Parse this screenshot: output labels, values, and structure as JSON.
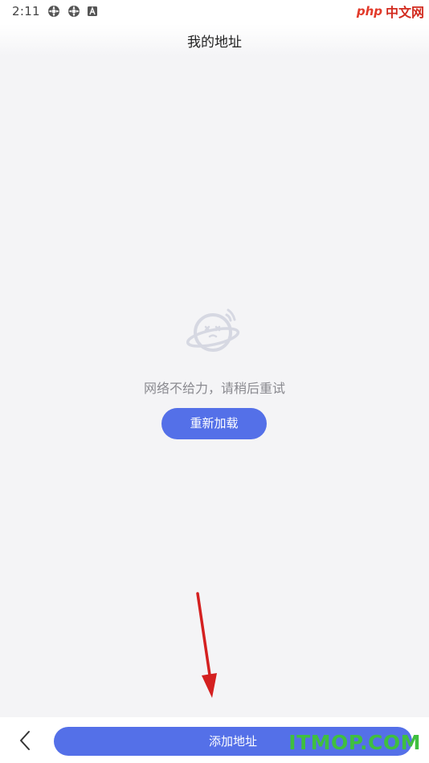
{
  "status_bar": {
    "time": "2:11",
    "icons": [
      "settings-gear-icon",
      "settings-gear-icon",
      "app-a-icon"
    ],
    "watermark_logo": "php",
    "watermark_text": "中文网"
  },
  "header": {
    "title": "我的地址"
  },
  "empty_state": {
    "icon": "planet-face-icon",
    "message": "网络不给力，请稍后重试",
    "reload_label": "重新加载"
  },
  "bottom_bar": {
    "back_icon": "chevron-left-icon",
    "add_label": "添加地址"
  },
  "watermark": "ITMOP.COM",
  "colors": {
    "accent": "#5470e8",
    "background": "#f4f4f6",
    "annotation_arrow": "#d42020",
    "watermark_green": "#3fbf3f"
  }
}
